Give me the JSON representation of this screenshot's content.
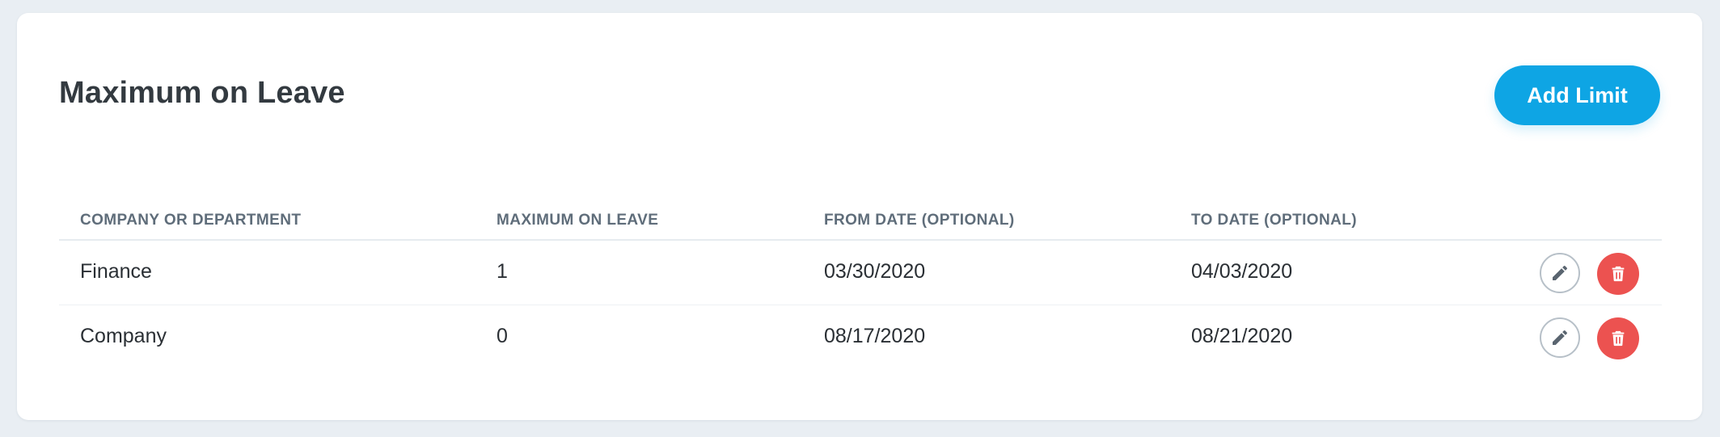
{
  "card": {
    "title": "Maximum on Leave",
    "add_button_label": "Add Limit"
  },
  "table": {
    "headers": [
      "COMPANY OR DEPARTMENT",
      "MAXIMUM ON LEAVE",
      "FROM DATE (OPTIONAL)",
      "TO DATE (OPTIONAL)"
    ],
    "rows": [
      {
        "name": "Finance",
        "maximum": "1",
        "from_date": "03/30/2020",
        "to_date": "04/03/2020"
      },
      {
        "name": "Company",
        "maximum": "0",
        "from_date": "08/17/2020",
        "to_date": "08/21/2020"
      }
    ],
    "row_actions": [
      {
        "icon": "pencil-icon",
        "label": "edit"
      },
      {
        "icon": "trash-icon",
        "label": "delete"
      }
    ]
  },
  "colors": {
    "accent": "#0ea5e4",
    "danger": "#ec5250",
    "background": "#e9eef3",
    "card": "#ffffff",
    "header_text": "#5f6d7a",
    "body_text": "#2a2f34"
  }
}
